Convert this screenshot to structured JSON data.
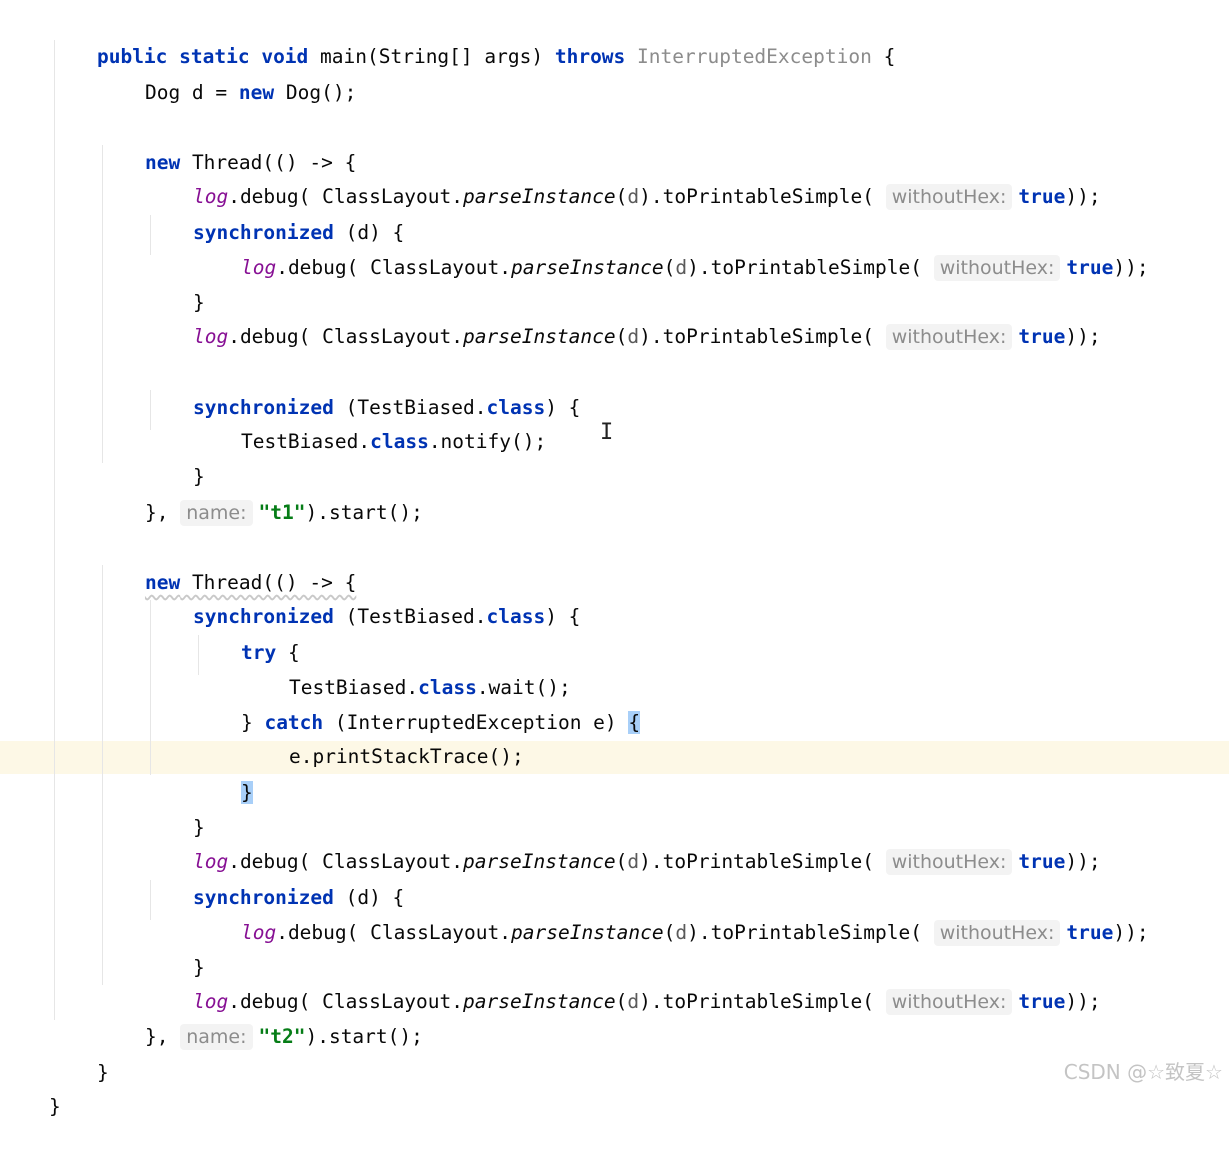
{
  "editor": {
    "lines": {
      "l01": {
        "kw1": "public static void",
        "t1": " main(String[] args) ",
        "kw2": "throws",
        "exc": " InterruptedException",
        "t2": " {"
      },
      "l02": {
        "t1": "Dog d = ",
        "kw1": "new",
        "t2": " Dog();"
      },
      "l03": {
        "kw1": "new",
        "t1": " Thread(() -> {"
      },
      "log": "log",
      "debug_pre": ".debug( ClassLayout.",
      "parse": "parseInstance",
      "lp": "(",
      "d": "d",
      "rp_to": ").toPrintableSimple( ",
      "hint_withoutHex": "withoutHex:",
      "true_kw": "true",
      "close_call": "));",
      "sync_kw": "synchronized",
      "sync_d": " (d) {",
      "close_brace": "}",
      "sync_class_pre": " (TestBiased.",
      "class_kw": "class",
      "sync_class_post": ") {",
      "notify_pre": "TestBiased.",
      "notify_post": ".notify();",
      "t1_close_pre": "}, ",
      "hint_name": "name:",
      "str_t1": "\"t1\"",
      "start_post": ").start();",
      "try_kw": "try",
      "try_post": " {",
      "wait_pre": "TestBiased.",
      "wait_post": ".wait();",
      "catch_pre": "} ",
      "catch_kw": "catch",
      "catch_post": " (InterruptedException e) ",
      "open_brace": "{",
      "print_trace": "e.printStackTrace();",
      "str_t2": "\"t2\""
    }
  },
  "watermark": "CSDN @☆致夏☆",
  "icons": {
    "text_cursor": "I-beam-cursor-icon"
  }
}
